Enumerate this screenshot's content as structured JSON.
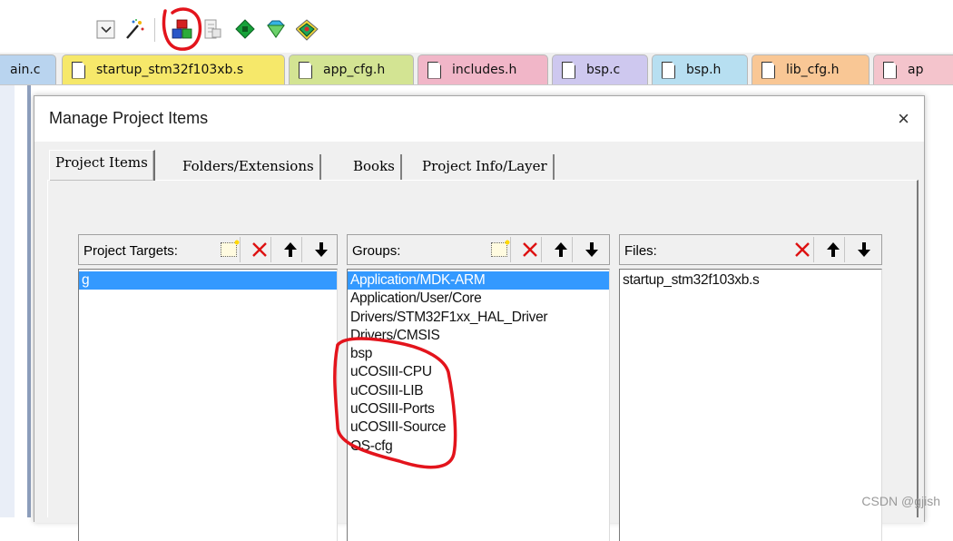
{
  "toolbar": {
    "icons": [
      "dropdown-arrow-icon",
      "magic-wand-icon",
      "manage-project-items-icon",
      "books-icon",
      "green-diamond-icon",
      "gem-icon",
      "multi-project-icon"
    ]
  },
  "tabs": [
    {
      "label": "ain.c",
      "color": "#b9d4ef",
      "icon": false
    },
    {
      "label": "startup_stm32f103xb.s",
      "color": "#f6e86a",
      "icon": true
    },
    {
      "label": "app_cfg.h",
      "color": "#d3e493",
      "icon": true
    },
    {
      "label": "includes.h",
      "color": "#f1b6c8",
      "icon": true
    },
    {
      "label": "bsp.c",
      "color": "#cec8ef",
      "icon": true
    },
    {
      "label": "bsp.h",
      "color": "#b7dff1",
      "icon": true
    },
    {
      "label": "lib_cfg.h",
      "color": "#f9c795",
      "icon": true
    },
    {
      "label": "ap",
      "color": "#f4c4cc",
      "icon": true
    }
  ],
  "dialog": {
    "title": "Manage Project Items",
    "close": "×",
    "tabs": [
      "Project Items",
      "Folders/Extensions",
      "Books",
      "Project Info/Layer"
    ],
    "targets": {
      "label": "Project Targets:",
      "items": [
        "g"
      ],
      "selected": 0
    },
    "groups": {
      "label": "Groups:",
      "items": [
        "Application/MDK-ARM",
        "Application/User/Core",
        "Drivers/STM32F1xx_HAL_Driver",
        "Drivers/CMSIS",
        "bsp",
        "uCOSIII-CPU",
        "uCOSIII-LIB",
        "uCOSIII-Ports",
        "uCOSIII-Source",
        "OS-cfg"
      ],
      "selected": 0
    },
    "files": {
      "label": "Files:",
      "items": [
        "startup_stm32f103xb.s"
      ]
    }
  },
  "colors": {
    "selection": "#3399ff",
    "annotation": "#e3141c"
  },
  "watermark": "CSDN @gjish"
}
